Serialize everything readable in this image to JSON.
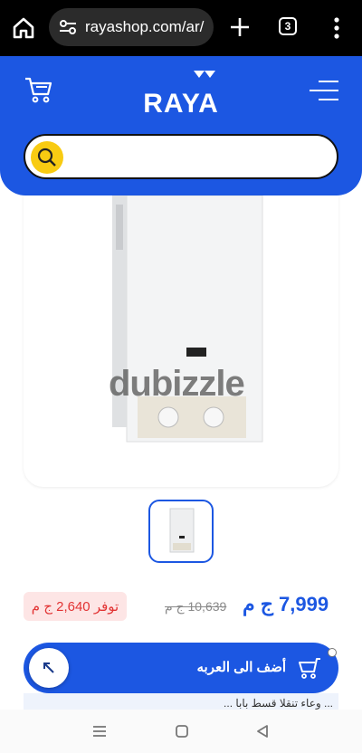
{
  "browser": {
    "url": "rayashop.com/ar/",
    "tab_count": "3"
  },
  "header": {
    "logo_text": "RAYA",
    "search": {
      "value": "",
      "placeholder": ""
    }
  },
  "product": {
    "watermark": "dubizzle",
    "price": "7,999 ج م",
    "old_price": "10,639 ج م",
    "savings": "توفر 2,640 ج م"
  },
  "actions": {
    "add_to_cart": "أضف الى العربه"
  },
  "description_snippet": "... وعاء تنقلا قسط بابا ...",
  "colors": {
    "brand_blue": "#1c57e2",
    "search_yellow": "#f8cb12",
    "savings_red": "#e23333",
    "savings_bg": "#fde5e5"
  },
  "icons": [
    "home-icon",
    "site-settings-icon",
    "new-tab-icon",
    "tabs-icon",
    "overflow-menu-icon",
    "cart-icon",
    "menu-icon",
    "search-icon",
    "scroll-up-icon",
    "recents-icon",
    "home-nav-icon",
    "back-icon"
  ]
}
